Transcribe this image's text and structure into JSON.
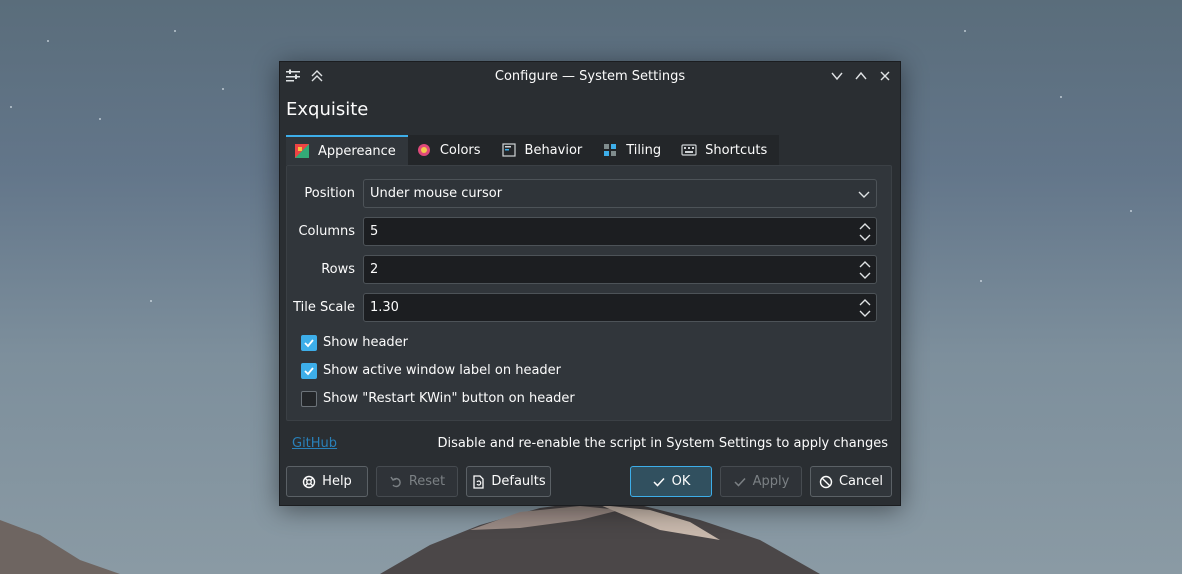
{
  "window": {
    "title": "Configure — System Settings"
  },
  "heading": "Exquisite",
  "tabs": [
    {
      "label": "Appereance",
      "active": true,
      "icon": "appearance-icon"
    },
    {
      "label": "Colors",
      "active": false,
      "icon": "colors-icon"
    },
    {
      "label": "Behavior",
      "active": false,
      "icon": "behavior-icon"
    },
    {
      "label": "Tiling",
      "active": false,
      "icon": "tiling-icon"
    },
    {
      "label": "Shortcuts",
      "active": false,
      "icon": "shortcuts-icon"
    }
  ],
  "form": {
    "position": {
      "label": "Position",
      "value": "Under mouse cursor"
    },
    "columns": {
      "label": "Columns",
      "value": "5"
    },
    "rows": {
      "label": "Rows",
      "value": "2"
    },
    "tile_scale": {
      "label": "Tile Scale",
      "value": "1.30"
    },
    "checkboxes": [
      {
        "label": "Show header",
        "checked": true
      },
      {
        "label": "Show active window label on header",
        "checked": true
      },
      {
        "label": "Show \"Restart KWin\" button on header",
        "checked": false
      }
    ]
  },
  "footer": {
    "link": "GitHub",
    "note": "Disable and re-enable the script in System Settings to apply changes"
  },
  "buttons": {
    "help": "Help",
    "reset": "Reset",
    "defaults": "Defaults",
    "ok": "OK",
    "apply": "Apply",
    "cancel": "Cancel"
  },
  "colors": {
    "accent": "#3daee9",
    "window_bg": "#2a2e32",
    "panel_bg": "#31363b",
    "link": "#2980b9"
  }
}
